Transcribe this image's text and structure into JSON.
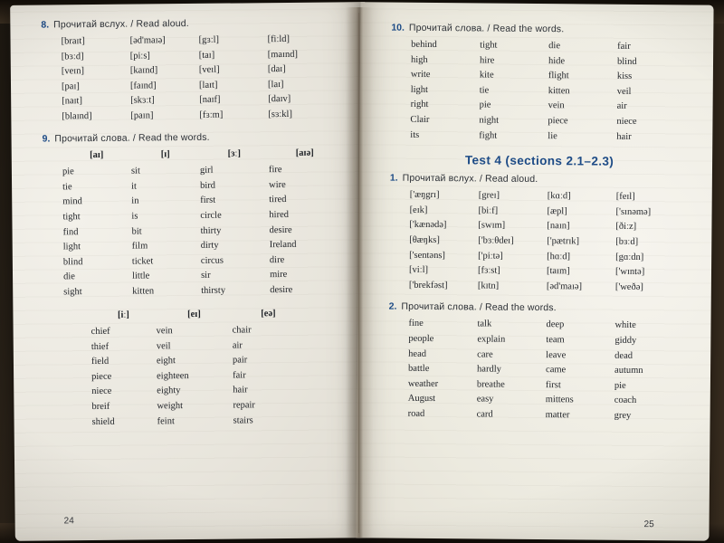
{
  "book": {
    "left_page": {
      "page_number": "24",
      "exercises": [
        {
          "number": "8.",
          "title": "Прочитай вслух. / Read aloud.",
          "layout": "4-column",
          "columns": [
            [
              "[braɪt]",
              "[bɜːd]",
              "[veɪn]",
              "[paɪ]",
              "[naɪt]",
              "[blaɪnd]"
            ],
            [
              "[əd'maɪə]",
              "[piːs]",
              "[kaɪnd]",
              "[faɪnd]",
              "[skɜːt]",
              "[paɪn]"
            ],
            [
              "[gɜːl]",
              "[taɪ]",
              "[veɪl]",
              "[laɪt]",
              "[naɪf]",
              "[fɜːm]"
            ],
            [
              "[fiːld]",
              "[maɪnd]",
              "[daɪ]",
              "[laɪ]",
              "[daɪv]",
              "[sɜːkl]"
            ]
          ]
        },
        {
          "number": "9.",
          "title": "Прочитай слова. / Read the words.",
          "layout": "4-column-with-headers",
          "headers": [
            "[aɪ]",
            "[ɪ]",
            "[ɜː]",
            "[aɪə]"
          ],
          "columns": [
            [
              "pie",
              "tie",
              "mind",
              "tight",
              "find",
              "light",
              "blind",
              "die",
              "sight"
            ],
            [
              "sit",
              "it",
              "in",
              "is",
              "bit",
              "film",
              "ticket",
              "little",
              "kitten"
            ],
            [
              "girl",
              "bird",
              "first",
              "circle",
              "thirty",
              "dirty",
              "circus",
              "sir",
              "thirsty"
            ],
            [
              "fire",
              "wire",
              "tired",
              "hired",
              "desire",
              "Ireland",
              "dire",
              "mire",
              "desire"
            ]
          ]
        },
        {
          "number": "",
          "title": "",
          "layout": "3-column-with-headers",
          "headers": [
            "[iː]",
            "[eɪ]",
            "[eə]"
          ],
          "columns": [
            [
              "chief",
              "thief",
              "field",
              "piece",
              "niece",
              "breif",
              "shield"
            ],
            [
              "vein",
              "veil",
              "eight",
              "eighteen",
              "eighty",
              "weight",
              "feint"
            ],
            [
              "chair",
              "air",
              "pair",
              "fair",
              "hair",
              "repair",
              "stairs"
            ]
          ]
        }
      ]
    },
    "right_page": {
      "page_number": "25",
      "test_heading": "Test 4 (sections 2.1–2.3)",
      "exercises": [
        {
          "number": "10.",
          "title": "Прочитай слова. / Read the words.",
          "layout": "4-column",
          "columns": [
            [
              "behind",
              "high",
              "write",
              "light",
              "right",
              "Clair",
              "its"
            ],
            [
              "tight",
              "hire",
              "kite",
              "tie",
              "pie",
              "night",
              "fight"
            ],
            [
              "die",
              "hide",
              "flight",
              "kitten",
              "vein",
              "piece",
              "lie"
            ],
            [
              "fair",
              "blind",
              "kiss",
              "veil",
              "air",
              "niece",
              "hair"
            ]
          ]
        },
        {
          "number": "1.",
          "title": "Прочитай вслух. / Read aloud.",
          "layout": "4-column",
          "columns": [
            [
              "['æŋgrɪ]",
              "[eɪk]",
              "['kænədə]",
              "[θæŋks]",
              "['sentəns]",
              "[viːl]",
              "['brekfəst]"
            ],
            [
              "[greɪ]",
              "[biːf]",
              "[swɪm]",
              "['bɜːθdeɪ]",
              "['piːtə]",
              "[fɜːst]",
              "[kɪtn]"
            ],
            [
              "[kɑːd]",
              "[æpl]",
              "[naɪn]",
              "['pætrɪk]",
              "[hɑːd]",
              "[taɪm]",
              "[əd'maɪə]"
            ],
            [
              "[feɪl]",
              "['sɪnəmə]",
              "[ðiːz]",
              "[bɜːd]",
              "[gɑːdn]",
              "['wɪntə]",
              "['weðə]"
            ]
          ]
        },
        {
          "number": "2.",
          "title": "Прочитай слова. / Read the words.",
          "layout": "4-column",
          "columns": [
            [
              "fine",
              "people",
              "head",
              "battle",
              "weather",
              "August",
              "road"
            ],
            [
              "talk",
              "explain",
              "care",
              "hardly",
              "breathe",
              "easy",
              "card"
            ],
            [
              "deep",
              "team",
              "leave",
              "came",
              "first",
              "mittens",
              "matter"
            ],
            [
              "white",
              "giddy",
              "dead",
              "autumn",
              "pie",
              "coach",
              "grey"
            ]
          ]
        }
      ]
    }
  },
  "colors": {
    "accent_blue": "#1d4b86",
    "text": "#24262b",
    "paper": "#e9e6de",
    "desk": "#2a2119"
  }
}
